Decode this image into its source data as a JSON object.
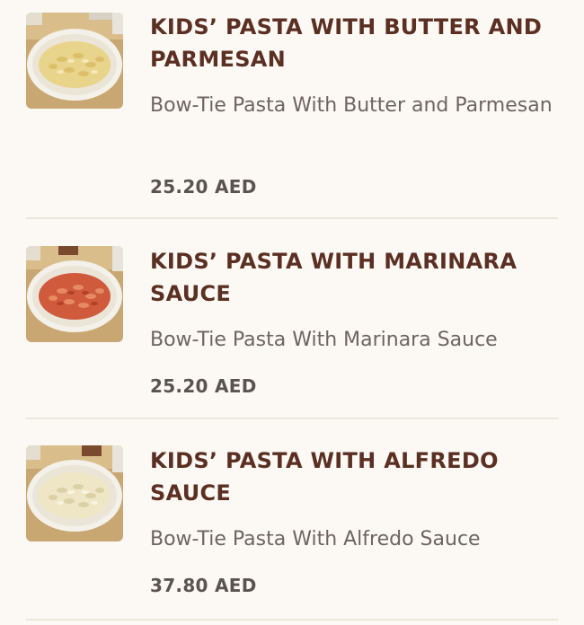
{
  "items": [
    {
      "title": "KIDS’ PASTA WITH BUTTER AND PARMESAN",
      "description": "Bow-Tie Pasta With Butter and Parmesan",
      "price": "25.20 AED",
      "image_icon": "pasta-butter-parmesan-image",
      "sauce_color": "#e9d48c"
    },
    {
      "title": "KIDS’ PASTA WITH MARINARA SAUCE",
      "description": "Bow-Tie Pasta With Marinara Sauce",
      "price": "25.20 AED",
      "image_icon": "pasta-marinara-image",
      "sauce_color": "#cf5a3c"
    },
    {
      "title": "KIDS’ PASTA WITH ALFREDO SAUCE",
      "description": "Bow-Tie Pasta With Alfredo Sauce",
      "price": "37.80 AED",
      "image_icon": "pasta-alfredo-image",
      "sauce_color": "#efe6c6"
    }
  ],
  "colors": {
    "background": "#fcf9f5",
    "title": "#5b2f22",
    "text": "#6e6460",
    "divider": "#ece7dc"
  }
}
